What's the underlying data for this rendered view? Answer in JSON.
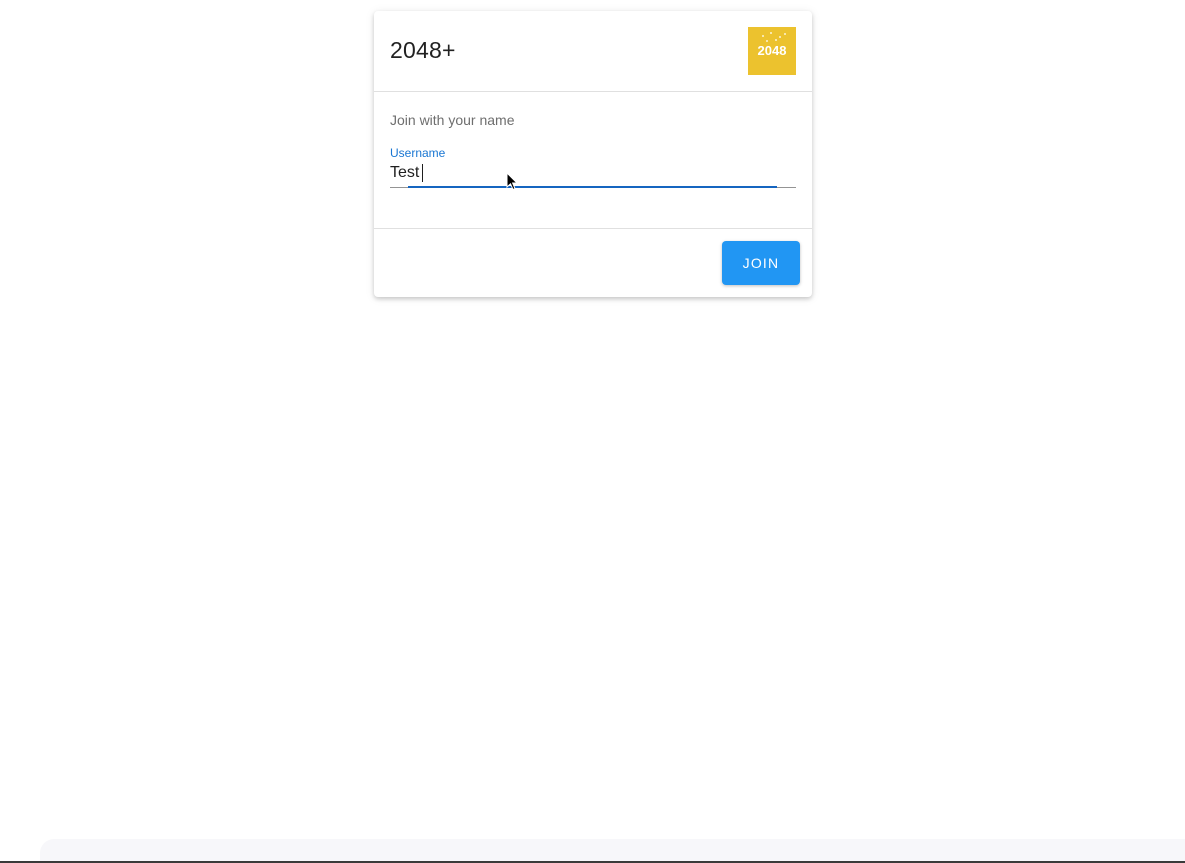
{
  "app": {
    "title": "2048+",
    "logo_text": "2048",
    "logo_color": "#ecc22e"
  },
  "form": {
    "subtitle": "Join with your name",
    "username": {
      "label": "Username",
      "value": "Test"
    },
    "join_label": "JOIN"
  },
  "colors": {
    "accent": "#1976d2",
    "button": "#2196f3"
  },
  "icons": {
    "cursor": "mouse-pointer-icon"
  }
}
